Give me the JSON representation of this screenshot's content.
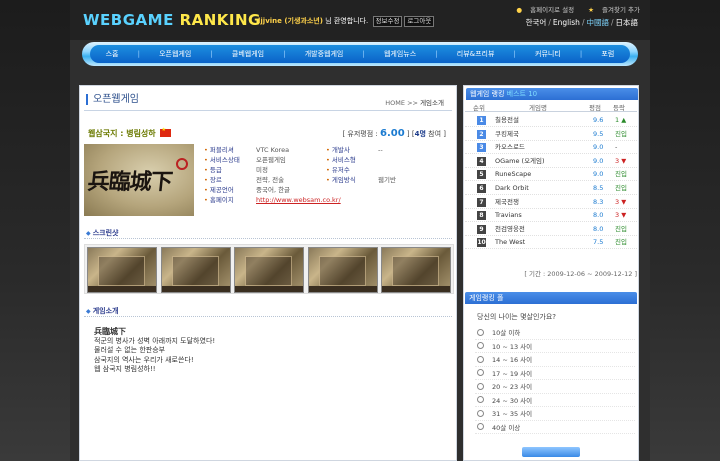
{
  "header": {
    "logo_part1": "WEBGAME",
    "logo_part2": "RANKING",
    "user_name": "ljjvine (기생과소년)",
    "welcome_suffix": " 님 환영합니다.",
    "btn_info": "정보수정",
    "btn_logout": "로그아웃",
    "top_link_home": "홈페이지로 설정",
    "top_link_fav": "즐겨찾기 추가",
    "languages": [
      "한국어",
      "English",
      "中國語",
      "日本語"
    ],
    "selected_language": "中國語"
  },
  "nav": {
    "items": [
      "스홈",
      "오픈웹게임",
      "클베웹게임",
      "개발중웹게임",
      "웹게임뉴스",
      "리뷰&프리뷰",
      "커뮤니티",
      "포럼"
    ]
  },
  "main": {
    "page_title": "오픈웹게임",
    "breadcrumb_home": "HOME",
    "breadcrumb_sep": ">>",
    "breadcrumb_current": "게임소개",
    "game_name": "웹삼국지 : 병림성하",
    "score_label": "[ 유저평점 :",
    "score_value": "6.00",
    "score_sep": "]",
    "score_count_open": "[",
    "score_count": "4명",
    "score_count_suffix": "참여 ]",
    "info": {
      "publisher_label": "퍼블리셔",
      "publisher": "VTC Korea",
      "developer_label": "개발사",
      "developer": "--",
      "service_status_label": "서비스상태",
      "service_status": "오픈웹게임",
      "service_style_label": "서비스형",
      "service_style": "",
      "grade_label": "등급",
      "grade": "미정",
      "users_label": "유저수",
      "users": "",
      "genre_label": "장르",
      "genre": "전략, 전술",
      "game_method_label": "게임방식",
      "game_method": "웹기반",
      "language_label": "제공언어",
      "language": "중국어, 한글",
      "homepage_label": "홈페이지",
      "homepage": "http://www.websam.co.kr/"
    },
    "screenshot_heading": "스크린샷",
    "intro_heading": "게임소개",
    "intro_title": "兵臨城下",
    "intro_lines": [
      "적군의 병사가 성벽 아래까지 도달하였다!",
      "물러설 수 없는 한판승부",
      "삼국지의 역사는 우리가 새로쓴다!",
      "웹 삼국지 병림성하!!"
    ]
  },
  "side": {
    "ranking_heading_prefix": "웹게임 랭킹",
    "ranking_heading_highlight": "베스트 10",
    "col_rank": "순위",
    "col_name": "게임명",
    "col_point": "평점",
    "col_change": "등락",
    "rankings": [
      {
        "rank": "1",
        "name": "칠용전설",
        "point": "9.6",
        "change": "1 ▲",
        "kind": "up"
      },
      {
        "rank": "2",
        "name": "쿠킹제국",
        "point": "9.5",
        "change": "진입",
        "kind": "new"
      },
      {
        "rank": "3",
        "name": "카오스로드",
        "point": "9.0",
        "change": "-",
        "kind": "same"
      },
      {
        "rank": "4",
        "name": "OGame (오게임)",
        "point": "9.0",
        "change": "3 ▼",
        "kind": "down"
      },
      {
        "rank": "5",
        "name": "RuneScape",
        "point": "9.0",
        "change": "진입",
        "kind": "new"
      },
      {
        "rank": "6",
        "name": "Dark Orbit",
        "point": "8.5",
        "change": "진입",
        "kind": "new"
      },
      {
        "rank": "7",
        "name": "제국전쟁",
        "point": "8.3",
        "change": "3 ▼",
        "kind": "down"
      },
      {
        "rank": "8",
        "name": "Travians",
        "point": "8.0",
        "change": "3 ▼",
        "kind": "down"
      },
      {
        "rank": "9",
        "name": "천검영웅전",
        "point": "8.0",
        "change": "진입",
        "kind": "new"
      },
      {
        "rank": "10",
        "name": "The West",
        "point": "7.5",
        "change": "진입",
        "kind": "new"
      }
    ],
    "period": "[ 기간 : 2009-12-06 ~ 2009-12-12 ]",
    "poll_heading": "게임랭킹 폴",
    "poll_question": "당신의 나이는 몇살인가요?",
    "poll_options": [
      "10살 이하",
      "10 ~ 13 사이",
      "14 ~ 16 사이",
      "17 ~ 19 사이",
      "20 ~ 23 사이",
      "24 ~ 30 사이",
      "31 ~ 35 사이",
      "40살 이상"
    ]
  }
}
